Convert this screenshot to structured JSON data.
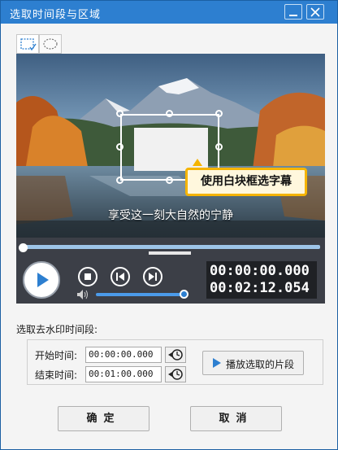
{
  "window": {
    "title": "选取时间段与区域"
  },
  "selection_modes": [
    {
      "name": "rectangle",
      "active": true
    },
    {
      "name": "ellipse",
      "active": false
    }
  ],
  "preview": {
    "tooltip": "使用白块框选字幕",
    "subtitle": "享受这一刻大自然的宁静"
  },
  "player": {
    "current_time": "00:00:00.000",
    "total_time": "00:02:12.054",
    "seek_progress": 0.0,
    "volume_level": 1.0
  },
  "range": {
    "section_label": "选取去水印时间段:",
    "start_label": "开始时间:",
    "start_value": "00:00:00.000",
    "end_label": "结束时间:",
    "end_value": "00:01:00.000",
    "play_segment_label": "播放选取的片段"
  },
  "buttons": {
    "ok": "确定",
    "cancel": "取消"
  },
  "colors": {
    "titlebar": "#2d7fd0",
    "accent": "#4b9bea",
    "tooltip_border": "#f5b400"
  }
}
